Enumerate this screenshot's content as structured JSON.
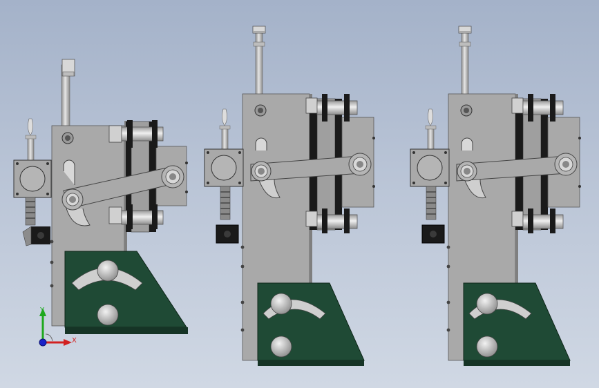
{
  "viewport": {
    "background_top": "#a4b2c9",
    "background_bottom": "#d0d8e4"
  },
  "colors": {
    "plate_gray": "#a9a9a9",
    "plate_gray_dark": "#8a8a8a",
    "base_green": "#1f4a35",
    "base_green_dark": "#163426",
    "steel": "#c8c8c8",
    "black_part": "#1a1a1a"
  },
  "triad": {
    "y_label": "Y",
    "x_label": "X",
    "y_color": "#1ea81e",
    "x_color": "#d22020",
    "z_color": "#1a22c8"
  },
  "assemblies": [
    {
      "name": "assembly-view-left",
      "arm_state": "lowered"
    },
    {
      "name": "assembly-view-middle",
      "arm_state": "level"
    },
    {
      "name": "assembly-view-right",
      "arm_state": "level"
    }
  ]
}
